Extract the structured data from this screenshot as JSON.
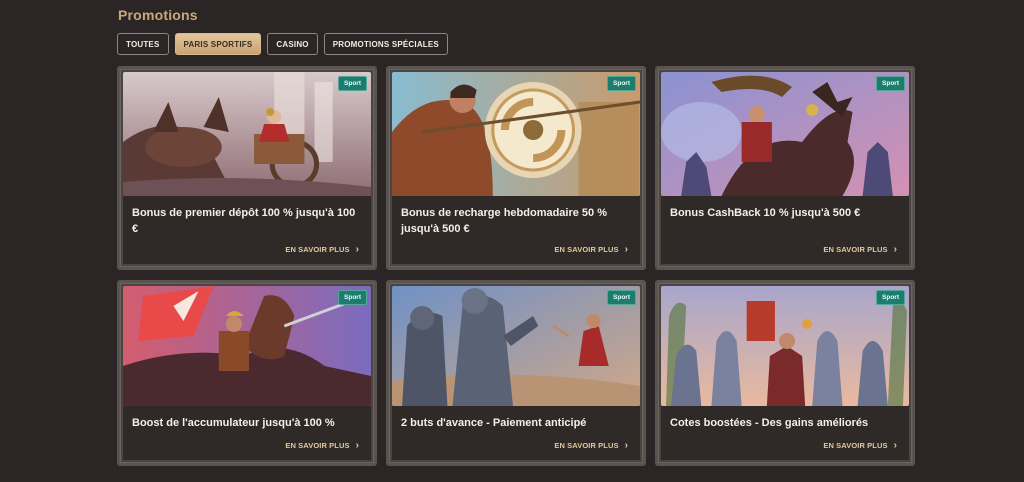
{
  "page": {
    "title": "Promotions"
  },
  "filters": [
    {
      "label": "TOUTES",
      "active": false
    },
    {
      "label": "PARIS SPORTIFS",
      "active": true
    },
    {
      "label": "CASINO",
      "active": false
    },
    {
      "label": "PROMOTIONS SPÉCIALES",
      "active": false
    }
  ],
  "cards": [
    {
      "badge": "Sport",
      "title": "Bonus de premier dépôt 100 % jusqu'à 100 €",
      "cta": "EN SAVOIR PLUS",
      "image": "chariot-race",
      "palette": [
        "#b89098",
        "#6f4a4a"
      ]
    },
    {
      "badge": "Sport",
      "title": "Bonus de recharge hebdomadaire 50 % jusqu'à 500 €",
      "cta": "EN SAVOIR PLUS",
      "image": "gladiator-shield",
      "palette": [
        "#7fb3c7",
        "#a05a2c"
      ]
    },
    {
      "badge": "Sport",
      "title": "Bonus CashBack 10 % jusqu'à 500 €",
      "cta": "EN SAVOIR PLUS",
      "image": "horseman-eagle",
      "palette": [
        "#8f8fc8",
        "#c07a9a"
      ]
    },
    {
      "badge": "Sport",
      "title": "Boost de l'accumulateur jusqu'à 100 %",
      "cta": "EN SAVOIR PLUS",
      "image": "cavalry-banners",
      "palette": [
        "#d7657a",
        "#6a6fb8"
      ]
    },
    {
      "badge": "Sport",
      "title": "2 buts d'avance - Paiement anticipé",
      "cta": "EN SAVOIR PLUS",
      "image": "armored-knights",
      "palette": [
        "#6f8fc0",
        "#b07f70"
      ]
    },
    {
      "badge": "Sport",
      "title": "Cotes boostées - Des gains améliorés",
      "cta": "EN SAVOIR PLUS",
      "image": "horses-5x",
      "palette": [
        "#a9a7c9",
        "#e2b49a"
      ]
    }
  ]
}
